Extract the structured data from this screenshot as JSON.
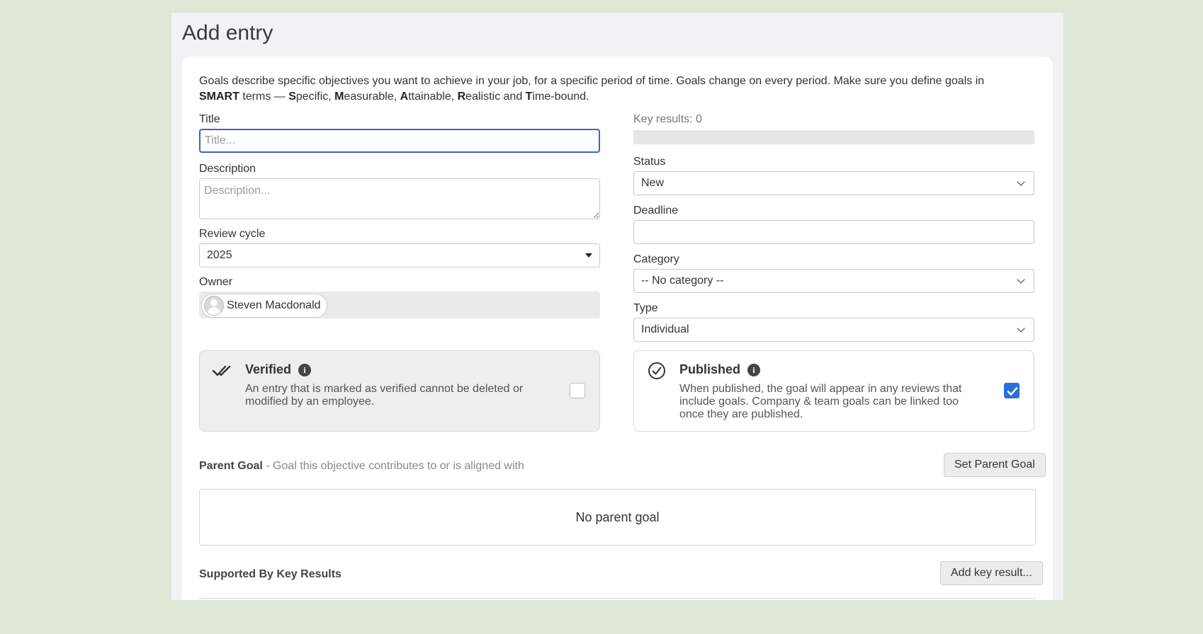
{
  "page": {
    "title": "Add entry"
  },
  "intro": {
    "line1": "Goals describe specific objectives you want to achieve in your job, for a specific period of time. Goals change on every period. Make sure you define goals in",
    "smart": "SMART",
    "terms": " terms — ",
    "words": [
      {
        "letter": "S",
        "rest": "pecific, "
      },
      {
        "letter": "M",
        "rest": "easurable, "
      },
      {
        "letter": "A",
        "rest": "ttainable, "
      },
      {
        "letter": "R",
        "rest": "ealistic and "
      },
      {
        "letter": "T",
        "rest": "ime-bound."
      }
    ]
  },
  "form": {
    "title_label": "Title",
    "title_placeholder": "Title...",
    "description_label": "Description",
    "description_placeholder": "Description...",
    "review_cycle_label": "Review cycle",
    "review_cycle_value": "2025",
    "owner_label": "Owner",
    "owner_name": "Steven Macdonald",
    "key_results_label": "Key results: 0",
    "key_results_progress": 0,
    "status_label": "Status",
    "status_value": "New",
    "deadline_label": "Deadline",
    "deadline_value": "",
    "category_label": "Category",
    "category_value": "-- No category --",
    "type_label": "Type",
    "type_value": "Individual"
  },
  "verified": {
    "title": "Verified",
    "description": "An entry that is marked as verified cannot be deleted or modified by an employee.",
    "checked": false
  },
  "published": {
    "title": "Published",
    "description": "When published, the goal will appear in any reviews that include goals. Company & team goals can be linked too once they are published.",
    "checked": true
  },
  "parent_goal": {
    "heading": "Parent Goal",
    "subheading": " - Goal this objective contributes to or is aligned with",
    "button": "Set Parent Goal",
    "empty_text": "No parent goal"
  },
  "key_results_section": {
    "heading": "Supported By Key Results",
    "button": "Add key result..."
  },
  "colors": {
    "background": "#dfe8d6",
    "focus_border": "#3b67b8",
    "checkbox_checked": "#2a6fdb"
  }
}
